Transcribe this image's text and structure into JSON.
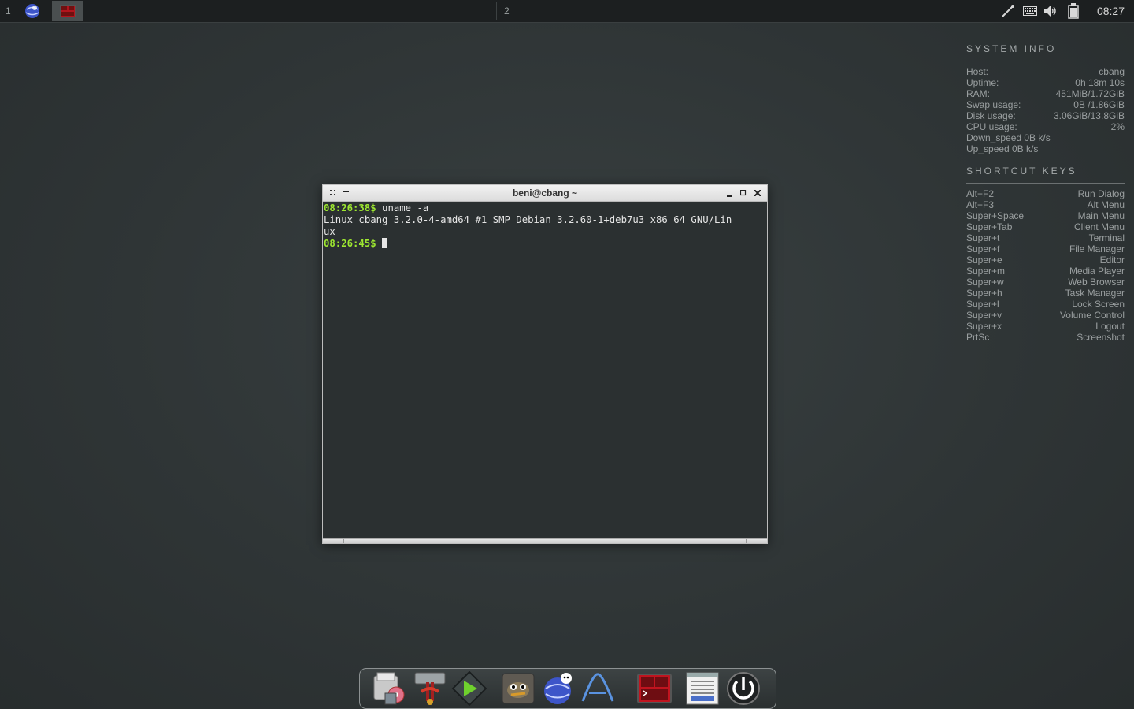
{
  "top_panel": {
    "workspace_1": "1",
    "workspace_2": "2",
    "clock": "08:27",
    "tray_icons": [
      "network-icon",
      "keyboard-icon",
      "volume-icon",
      "battery-icon"
    ]
  },
  "conky": {
    "system_info": {
      "title": "SYSTEM INFO",
      "rows": [
        {
          "label": "Host:",
          "value": "cbang"
        },
        {
          "label": "Uptime:",
          "value": "0h 18m 10s"
        },
        {
          "label": "RAM:",
          "value": "451MiB/1.72GiB"
        },
        {
          "label": "Swap usage:",
          "value": "0B  /1.86GiB"
        },
        {
          "label": "Disk usage:",
          "value": "3.06GiB/13.8GiB"
        },
        {
          "label": "CPU usage:",
          "value": "2%"
        },
        {
          "label": "Down_speed 0B   k/s",
          "value": ""
        },
        {
          "label": "Up_speed 0B   k/s",
          "value": ""
        }
      ]
    },
    "shortcut_keys": {
      "title": "SHORTCUT KEYS",
      "rows": [
        {
          "key": "Alt+F2",
          "action": "Run Dialog"
        },
        {
          "key": "Alt+F3",
          "action": "Alt Menu"
        },
        {
          "key": "Super+Space",
          "action": "Main Menu"
        },
        {
          "key": "Super+Tab",
          "action": "Client Menu"
        },
        {
          "key": "Super+t",
          "action": "Terminal"
        },
        {
          "key": "Super+f",
          "action": "File Manager"
        },
        {
          "key": "Super+e",
          "action": "Editor"
        },
        {
          "key": "Super+m",
          "action": "Media Player"
        },
        {
          "key": "Super+w",
          "action": "Web Browser"
        },
        {
          "key": "Super+h",
          "action": "Task Manager"
        },
        {
          "key": "Super+l",
          "action": "Lock Screen"
        },
        {
          "key": "Super+v",
          "action": "Volume Control"
        },
        {
          "key": "Super+x",
          "action": "Logout"
        },
        {
          "key": "PrtSc",
          "action": "Screenshot"
        }
      ]
    }
  },
  "terminal": {
    "title": "beni@cbang ~",
    "lines": [
      {
        "prompt": "08:26:38$",
        "text": " uname -a"
      },
      {
        "prompt": "",
        "text": "Linux cbang 3.2.0-4-amd64 #1 SMP Debian 3.2.60-1+deb7u3 x86_64 GNU/Lin"
      },
      {
        "prompt": "",
        "text": "ux"
      },
      {
        "prompt": "08:26:45$",
        "text": " "
      }
    ]
  },
  "dock": {
    "items": [
      "file-manager-icon",
      "settings-tools-icon",
      "media-player-icon",
      "gimp-icon",
      "web-browser-icon",
      "editor-icon",
      "terminal-icon",
      "task-manager-icon",
      "power-icon"
    ]
  },
  "colors": {
    "prompt": "#9ee830",
    "terminal_bg": "#2b3031",
    "desktop_bg": "#2f3536",
    "panel_bg": "#1c1f20"
  }
}
